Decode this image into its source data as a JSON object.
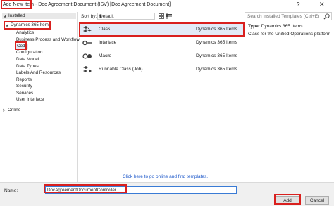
{
  "window": {
    "title_prefix": "Add New Item",
    "title_rest": " - Doc Agreement Document (ISV) [Doc Agreement Document]",
    "help_glyph": "?",
    "close_glyph": "✕"
  },
  "tree": {
    "installed": "Installed",
    "root": "Dynamics 365 Items",
    "children": [
      "Analytics",
      "Business Process and Workflow",
      "Code",
      "Configuration",
      "Data Model",
      "Data Types",
      "Labels And Resources",
      "Reports",
      "Security",
      "Services",
      "User Interface"
    ],
    "online": "Online"
  },
  "sort": {
    "label": "Sort by:",
    "value": "Default"
  },
  "search": {
    "placeholder": "Search Installed Templates (Ctrl+E)"
  },
  "templates": [
    {
      "name": "Class",
      "category": "Dynamics 365 Items",
      "icon": "class-icon",
      "selected": true
    },
    {
      "name": "Interface",
      "category": "Dynamics 365 Items",
      "icon": "interface-icon",
      "selected": false
    },
    {
      "name": "Macro",
      "category": "Dynamics 365 Items",
      "icon": "macro-icon",
      "selected": false
    },
    {
      "name": "Runnable Class (Job)",
      "category": "Dynamics 365 Items",
      "icon": "runnable-class-icon",
      "selected": false
    }
  ],
  "online_link": "Click here to go online and find templates.",
  "details": {
    "type_label": "Type:",
    "type_value": "Dynamics 365 Items",
    "description": "Class for the Unified Operations platform"
  },
  "name": {
    "label": "Name:",
    "value": "DocAgreementDocumentController"
  },
  "buttons": {
    "add": "Add",
    "cancel": "Cancel"
  },
  "colors": {
    "highlight": "#d9201e",
    "selection": "#e3ebf7",
    "link": "#1a56c9"
  }
}
